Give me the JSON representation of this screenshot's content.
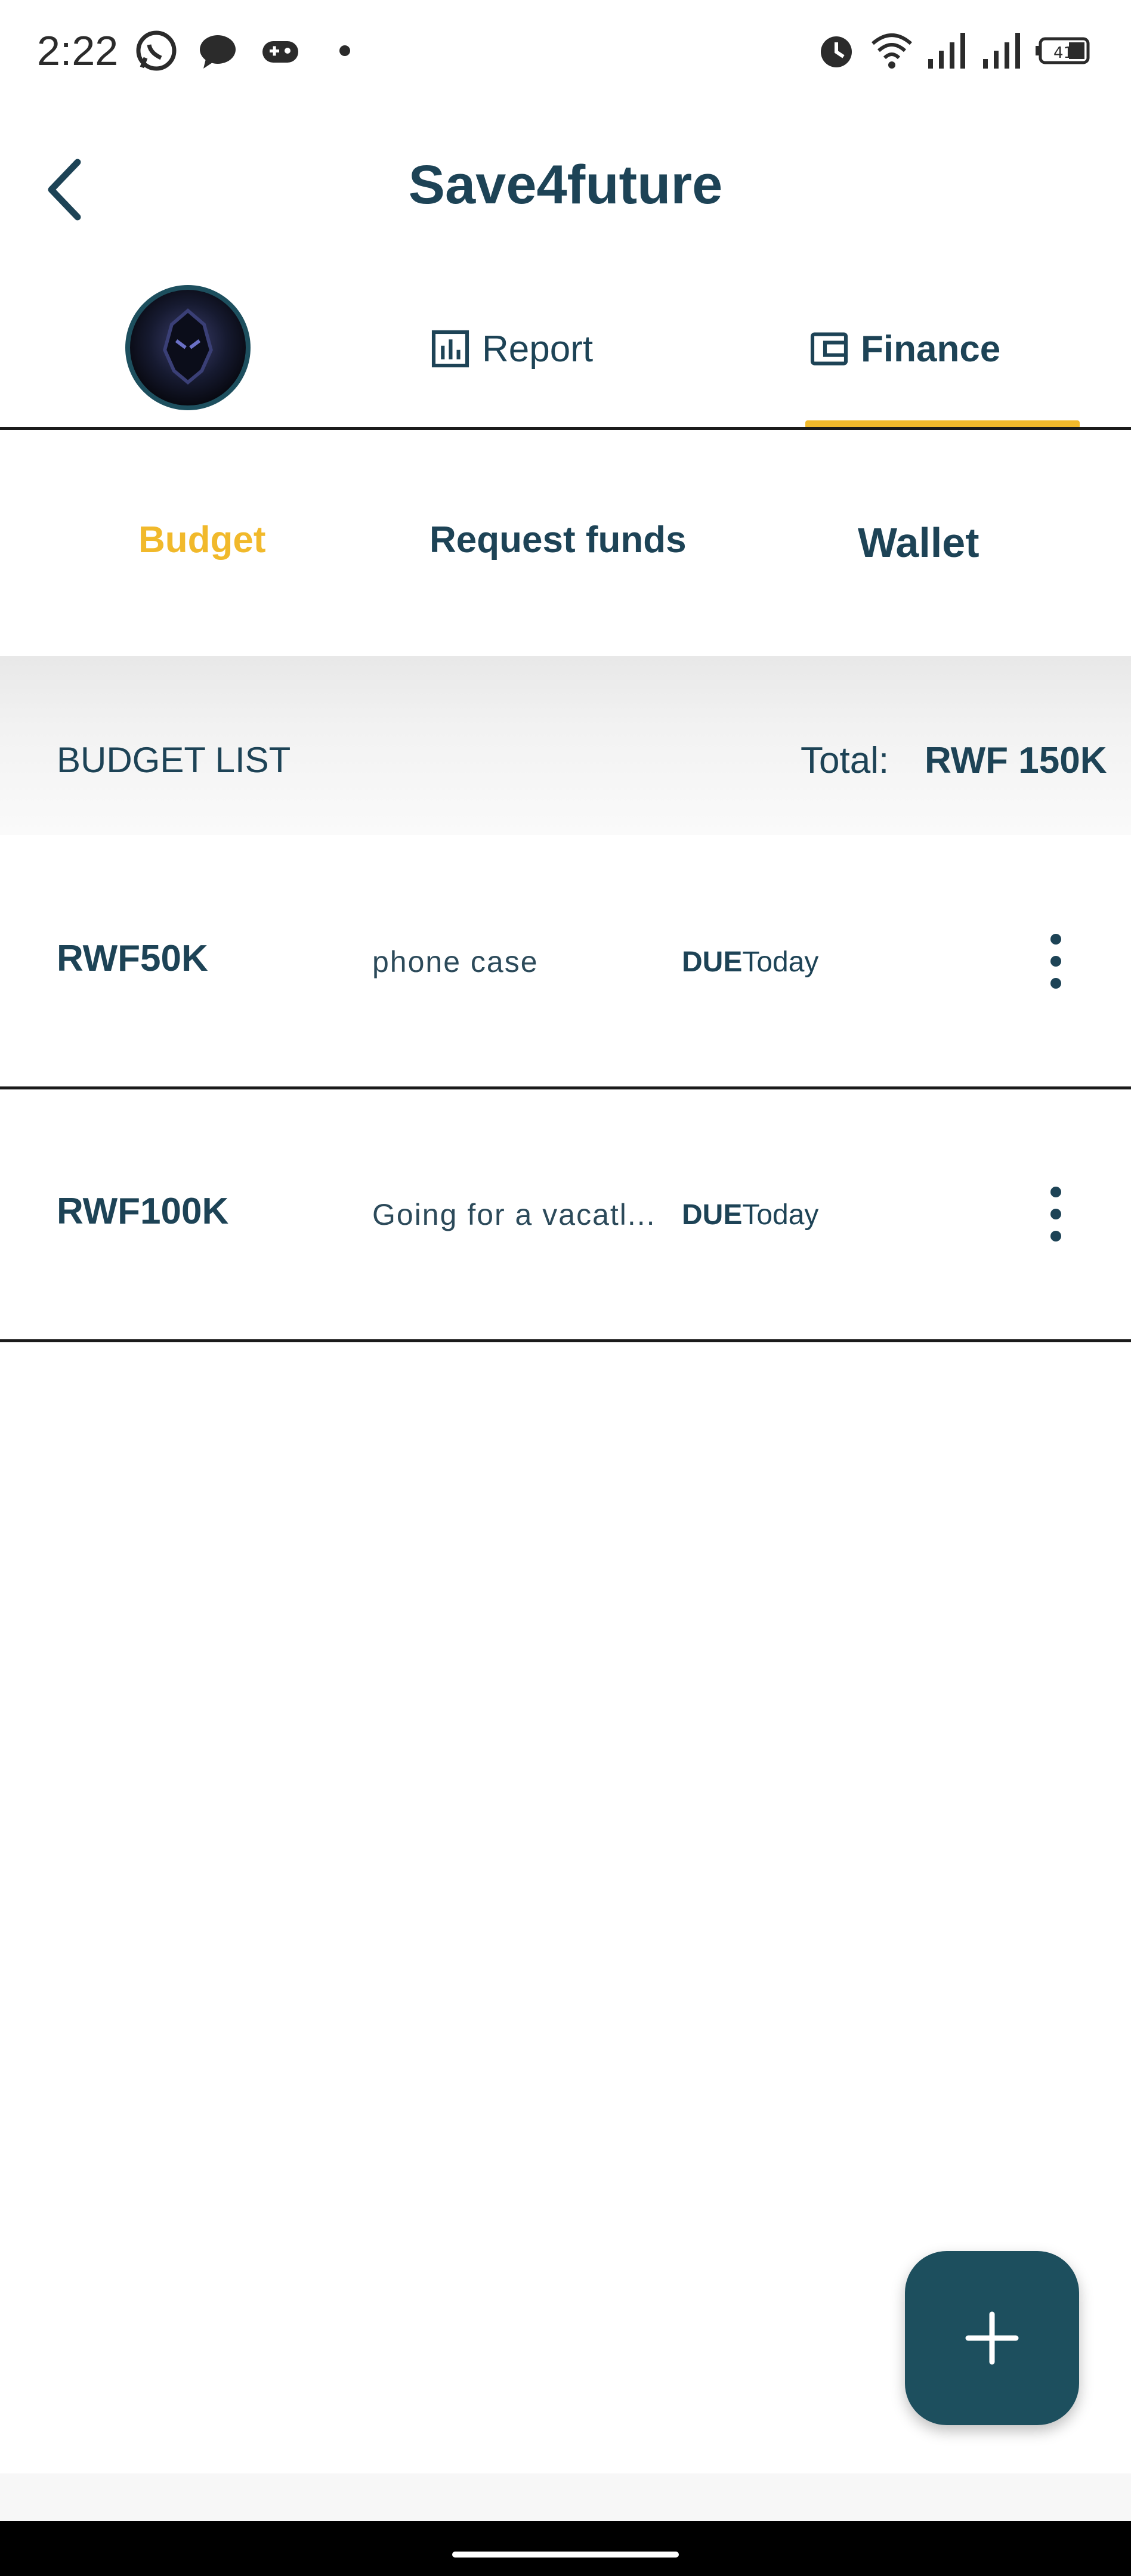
{
  "status_bar": {
    "time": "2:22",
    "icons": [
      "whatsapp-icon",
      "message-icon",
      "game-controller-icon",
      "dot-icon",
      "alarm-icon",
      "wifi-icon",
      "signal-icon",
      "signal-icon",
      "battery-icon"
    ],
    "battery_level": "41"
  },
  "header": {
    "title": "Save4future",
    "back_icon": "chevron-left-icon"
  },
  "top_tabs": [
    {
      "label": "",
      "icon": "avatar"
    },
    {
      "label": "Report",
      "icon": "bar-chart-icon"
    },
    {
      "label": "Finance",
      "icon": "wallet-icon",
      "active": true
    }
  ],
  "sub_tabs": [
    {
      "label": "Budget",
      "active": true
    },
    {
      "label": "Request funds"
    },
    {
      "label": "Wallet"
    }
  ],
  "budget_list": {
    "title": "BUDGET LIST",
    "total_label": "Total:",
    "total_value": "RWF 150K",
    "rows": [
      {
        "amount": "RWF50K",
        "description": "phone case",
        "due_label": "DUE",
        "due_value": "Today"
      },
      {
        "amount": "RWF100K",
        "description": "Going for a vacatl...",
        "due_label": "DUE",
        "due_value": "Today"
      }
    ]
  },
  "fab": {
    "icon": "plus-icon"
  },
  "colors": {
    "primary": "#1d4356",
    "accent": "#f1b92b",
    "fab": "#1d4f5e"
  }
}
